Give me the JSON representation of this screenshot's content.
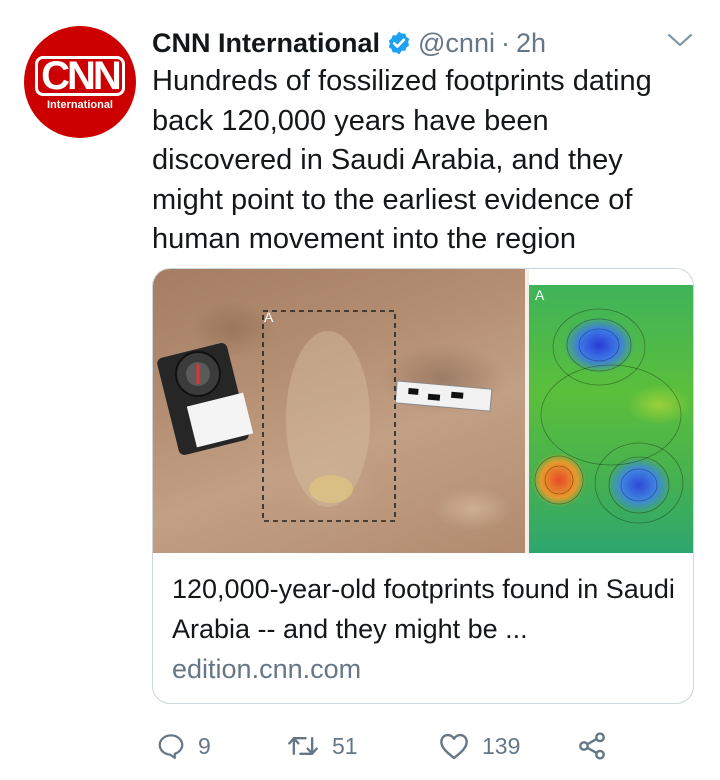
{
  "account": {
    "name": "CNN International",
    "handle": "@cnni",
    "separator": "·",
    "time": "2h",
    "avatar_logo": "CNN",
    "avatar_subtitle": "International"
  },
  "tweet": {
    "text": "Hundreds of fossilized footprints dating back 120,000 years have been discovered in Saudi Arabia, and they might point to the earliest evidence of human movement into the region"
  },
  "card": {
    "title": "120,000-year-old footprints found in Saudi Arabia -- and they might be ...",
    "domain": "edition.cnn.com",
    "photo_label": "A",
    "map_label": "A"
  },
  "actions": {
    "replies": "9",
    "retweets": "51",
    "likes": "139"
  },
  "icons": [
    "verified-icon",
    "chevron-down-icon",
    "reply-icon",
    "retweet-icon",
    "like-icon",
    "share-icon"
  ],
  "colors": {
    "brand_red": "#cc0000",
    "verified_blue": "#1da1f2",
    "secondary_text": "#657786"
  }
}
